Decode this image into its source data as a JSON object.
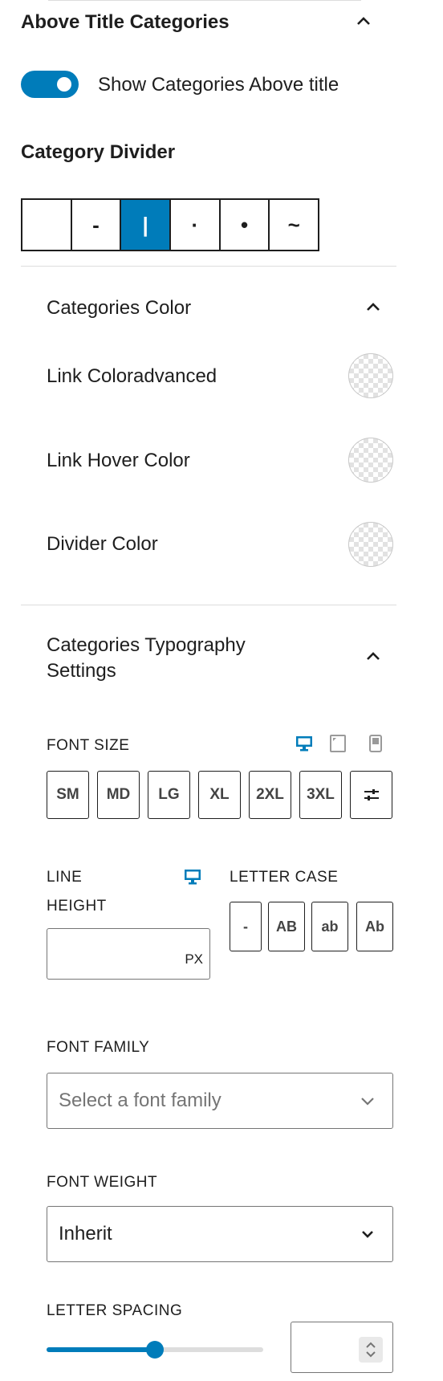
{
  "above_title": {
    "title": "Above Title Categories",
    "toggle_label": "Show Categories Above title",
    "toggle_on": true
  },
  "category_divider": {
    "title": "Category Divider",
    "options": [
      "",
      "-",
      "|",
      "·",
      "•",
      "~"
    ],
    "selected_index": 2
  },
  "categories_color": {
    "title": "Categories Color",
    "items": [
      {
        "label": "Link Coloradvanced"
      },
      {
        "label": "Link Hover Color"
      },
      {
        "label": "Divider Color"
      }
    ]
  },
  "typography": {
    "title_line1": "Categories Typography",
    "title_line2": "Settings",
    "font_size": {
      "label": "FONT SIZE",
      "presets": [
        "SM",
        "MD",
        "LG",
        "XL",
        "2XL",
        "3XL"
      ],
      "devices": [
        "desktop-icon",
        "tablet-icon",
        "mobile-icon"
      ]
    },
    "line_height": {
      "label_line1": "LINE",
      "label_line2": "HEIGHT",
      "value": "",
      "unit": "PX"
    },
    "letter_case": {
      "label": "LETTER CASE",
      "options": [
        "-",
        "AB",
        "ab",
        "Ab"
      ]
    },
    "font_family": {
      "label": "FONT FAMILY",
      "placeholder": "Select a font family"
    },
    "font_weight": {
      "label": "FONT WEIGHT",
      "value": "Inherit"
    },
    "letter_spacing": {
      "label": "LETTER SPACING",
      "slider_fraction": 0.5,
      "value": ""
    }
  },
  "colors": {
    "accent": "#007cba",
    "text": "#1e1e1e",
    "muted": "#757575",
    "border": "#dddddd"
  }
}
